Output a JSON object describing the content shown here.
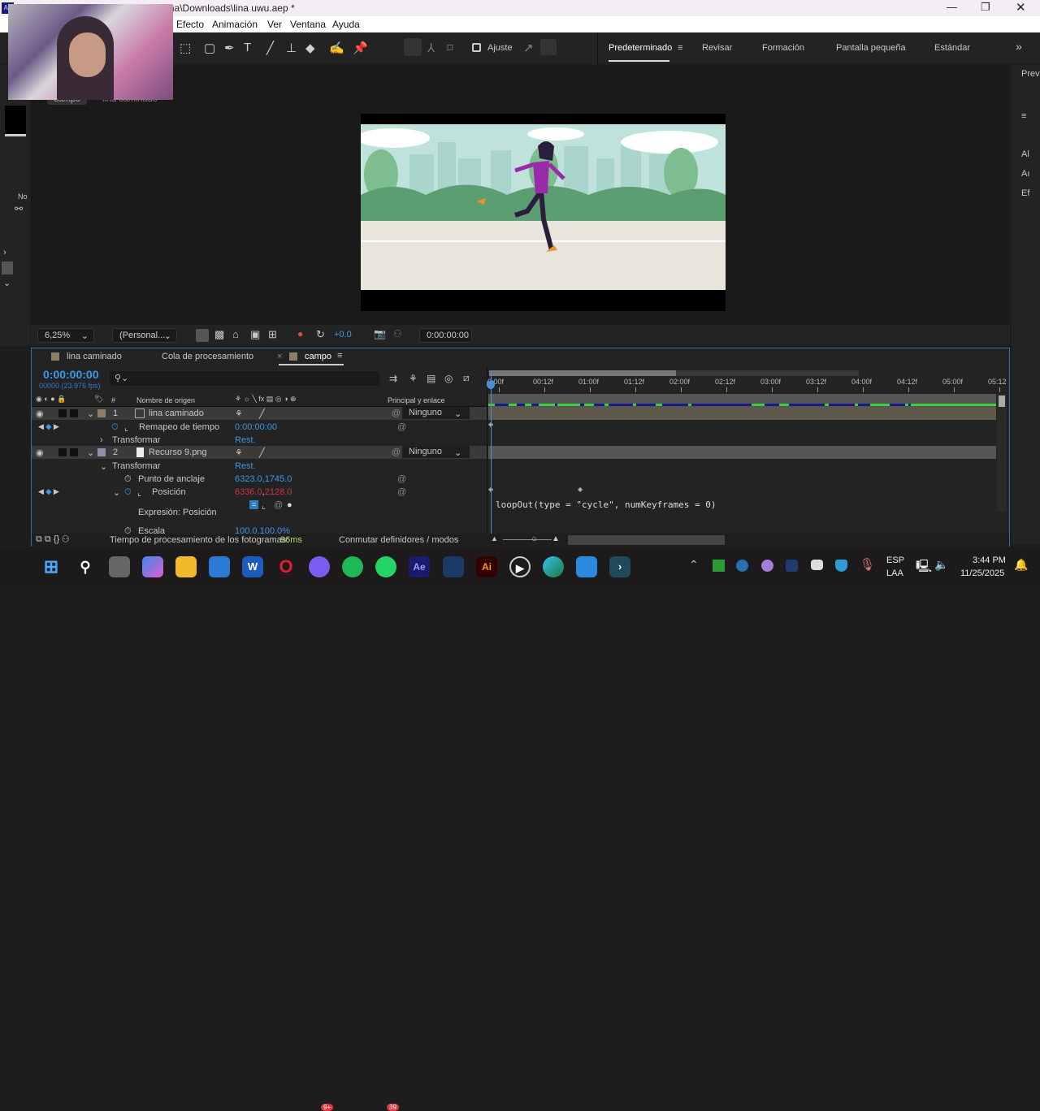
{
  "window": {
    "title": "Adobe After Effects 2025 - C:\\U...\\lina\\Downloads\\lina uwu.aep *",
    "app_icon": "Ae"
  },
  "menu": [
    "Efecto",
    "Animación",
    "Ver",
    "Ventana",
    "Ayuda"
  ],
  "toolbar": {
    "snap_label": "Ajuste"
  },
  "workspaces": [
    "Predeterminado",
    "Revisar",
    "Formación",
    "Pantalla pequeña",
    "Estándar"
  ],
  "workspace_more": "»",
  "comp_breadcrumb": {
    "comp": "campo",
    "layer": "lina caminado"
  },
  "left_panel": {
    "label": "No"
  },
  "right_panel": {
    "items": [
      "Prev",
      "≡",
      "Al",
      "Aı",
      "Ef"
    ]
  },
  "viewer_bar": {
    "zoom": "6,25%",
    "view": "(Personal...",
    "exposure": "+0.0",
    "timecode": "0:00:00:00"
  },
  "timeline": {
    "tabs": [
      {
        "label": "lina caminado",
        "color": "#8a7f62"
      },
      {
        "label": "Cola de procesamiento"
      },
      {
        "label": "campo",
        "color": "#8a7f62",
        "active": true
      }
    ],
    "close": "×",
    "menu_icon": "≡",
    "current_time": "0:00:00:00",
    "frame_info": "00000 (23.976 fps)",
    "columns": {
      "num": "#",
      "source": "Nombre de origen",
      "parent": "Principal y enlace"
    },
    "ruler": [
      "0:00f",
      "00:12f",
      "01:00f",
      "01:12f",
      "02:00f",
      "02:12f",
      "03:00f",
      "03:12f",
      "04:00f",
      "04:12f",
      "05:00f",
      "05:12"
    ],
    "layers": [
      {
        "num": "1",
        "name": "lina caminado",
        "parent": "Ninguno",
        "label_color": "#8a7f62"
      },
      {
        "num": "2",
        "name": "Recurso 9.png",
        "parent": "Ninguno",
        "label_color": "#8f8fb0"
      }
    ],
    "props": {
      "remap": "Remapeo de tiempo",
      "remap_val": "0:00:00:00",
      "transform": "Transformar",
      "reset": "Rest.",
      "anchor": "Punto de anclaje",
      "anchor_val": "6323.0,1745.0",
      "position": "Posición",
      "position_val_x": "6336.0",
      "position_val_y": "2128.0",
      "expr_label": "Expresión: Posición",
      "expression": "loopOut(type = \"cycle\", numKeyframes = 0)",
      "scale": "Escala",
      "scale_val": "100.0,100.0%"
    },
    "footer": {
      "render_label": "Tiempo de procesamiento de los fotogramas:",
      "render_val": "96ms",
      "toggle": "Conmutar definidores / modos"
    }
  },
  "taskbar": {
    "lang": "ESP",
    "layout": "LAA",
    "time": "3:44 PM",
    "date": "11/25/2025",
    "badges": {
      "discord": "9+",
      "whatsapp": "39"
    }
  }
}
